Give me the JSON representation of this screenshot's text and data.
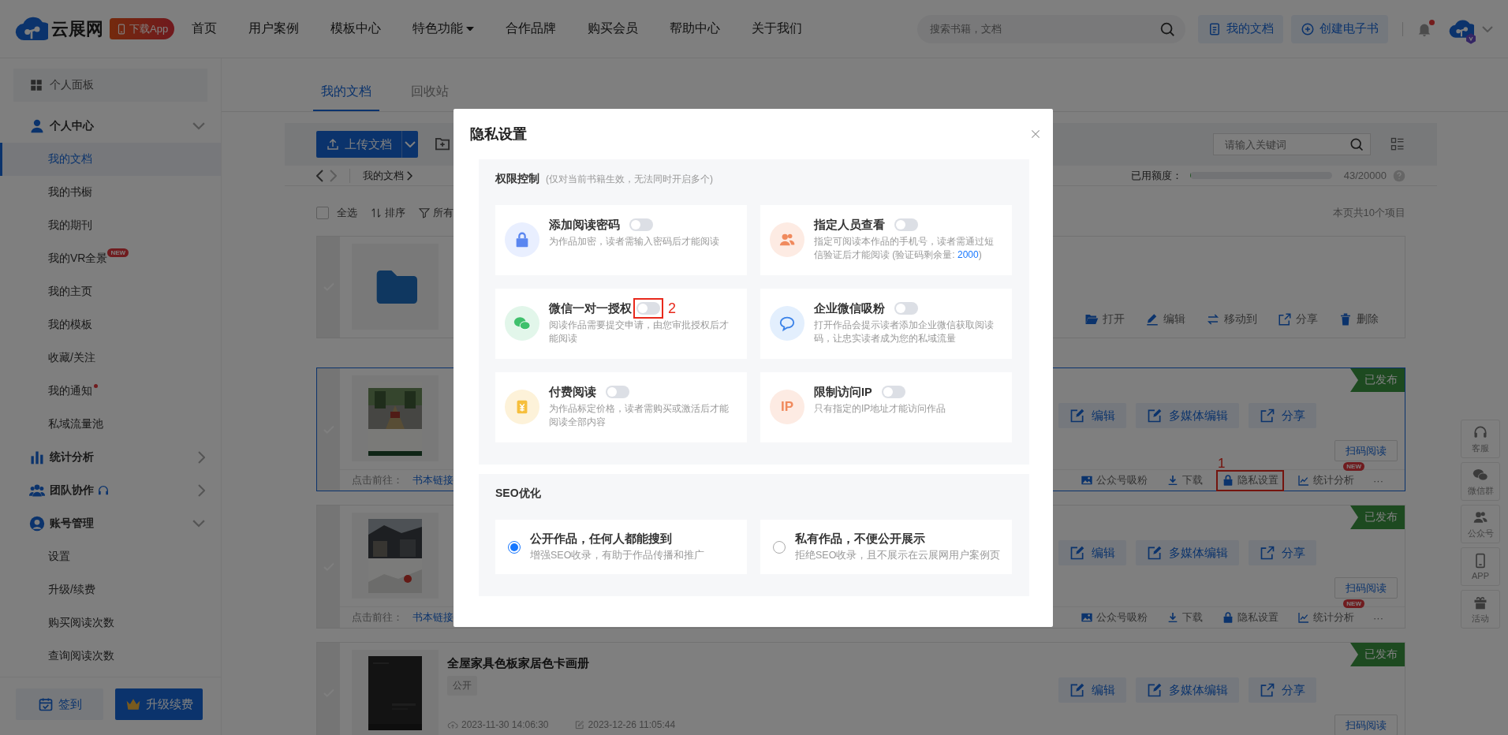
{
  "header": {
    "logo": "云展网",
    "app_badge": "下载App",
    "nav": [
      {
        "label": "首页",
        "dropdown": false
      },
      {
        "label": "用户案例",
        "dropdown": false
      },
      {
        "label": "模板中心",
        "dropdown": false
      },
      {
        "label": "特色功能",
        "dropdown": true
      },
      {
        "label": "合作品牌",
        "dropdown": false
      },
      {
        "label": "购买会员",
        "dropdown": false
      },
      {
        "label": "帮助中心",
        "dropdown": false
      },
      {
        "label": "关于我们",
        "dropdown": false
      }
    ],
    "search": {
      "placeholder": "搜索书籍，文档"
    },
    "buttons": [
      {
        "label": "我的文档",
        "kind": "docs"
      },
      {
        "label": "创建电子书",
        "kind": "create"
      }
    ],
    "notification_dot": true
  },
  "sidebar": {
    "dashboard": "个人面板",
    "groups": [
      {
        "label": "个人中心",
        "expanded": true,
        "children": [
          {
            "label": "我的文档",
            "selected": true
          },
          {
            "label": "我的书橱",
            "selected": false
          },
          {
            "label": "我的期刊",
            "selected": false
          },
          {
            "label": "我的VR全景",
            "selected": false,
            "badge": "NEW"
          },
          {
            "label": "我的主页",
            "selected": false
          },
          {
            "label": "我的模板",
            "selected": false
          },
          {
            "label": "收藏/关注",
            "selected": false
          },
          {
            "label": "我的通知",
            "selected": false,
            "dot": true
          },
          {
            "label": "私域流量池",
            "selected": false
          }
        ]
      },
      {
        "label": "统计分析",
        "expanded": false
      },
      {
        "label": "团队协作",
        "expanded": false
      },
      {
        "label": "账号管理",
        "expanded": true,
        "children": [
          {
            "label": "设置",
            "selected": false
          },
          {
            "label": "升级/续费",
            "selected": false
          },
          {
            "label": "购买阅读次数",
            "selected": false
          },
          {
            "label": "查询阅读次数",
            "selected": false
          }
        ]
      }
    ],
    "buttons": [
      {
        "label": "签到",
        "kind": "checkin"
      },
      {
        "label": "升级续费",
        "kind": "upgrade"
      }
    ]
  },
  "tabs": [
    {
      "label": "我的文档",
      "selected": true
    },
    {
      "label": "回收站",
      "selected": false
    }
  ],
  "toolbar": {
    "upload": "上传文档",
    "search": {
      "placeholder": "请输入关键词"
    }
  },
  "breadcrumb": "我的文档",
  "quota": {
    "label": "已用额度：",
    "level": 0.003,
    "reading": "43/20000"
  },
  "list_bar": {
    "select_all": "全选",
    "checked": false,
    "sort": "排序",
    "filter": "所有",
    "count": "本页共10个项目"
  },
  "documents": [
    {
      "kind": "folder",
      "selected": false,
      "actions": [
        "打开",
        "编辑",
        "移动到",
        "分享",
        "删除"
      ]
    },
    {
      "kind": "book",
      "selected": true,
      "status": "已发布",
      "buttons": [
        "编辑",
        "多媒体编辑",
        "分享"
      ],
      "scan": "扫码阅读",
      "footer": {
        "label": "点击前往：",
        "link": "书本链接",
        "actions": [
          {
            "label": "公众号吸粉",
            "highlighted": false
          },
          {
            "label": "下载",
            "highlighted": false
          },
          {
            "label": "隐私设置",
            "highlighted": true,
            "marker": "1"
          },
          {
            "label": "统计分析",
            "highlighted": false,
            "badge": "NEW"
          },
          {
            "label": "···",
            "highlighted": false
          }
        ]
      }
    },
    {
      "kind": "book",
      "selected": false,
      "status": "已发布",
      "buttons": [
        "编辑",
        "多媒体编辑",
        "分享"
      ],
      "scan": "扫码阅读",
      "footer": {
        "label": "点击前往：",
        "link": "书本链接",
        "actions": [
          {
            "label": "公众号吸粉",
            "highlighted": false
          },
          {
            "label": "下载",
            "highlighted": false
          },
          {
            "label": "隐私设置",
            "highlighted": false
          },
          {
            "label": "统计分析",
            "highlighted": false,
            "badge": "NEW"
          },
          {
            "label": "···",
            "highlighted": false
          }
        ]
      }
    },
    {
      "kind": "book",
      "selected": false,
      "title": "全屋家具色板家居色卡画册",
      "tag": "公开",
      "created": "2023-11-30 14:06:30",
      "updated": "2023-12-26 11:05:44",
      "status": "已发布",
      "buttons": [
        "编辑",
        "多媒体编辑",
        "分享"
      ],
      "scan": "扫码阅读"
    }
  ],
  "float_bar": [
    "客服",
    "微信群",
    "公众号",
    "APP",
    "活动"
  ],
  "modal": {
    "title": "隐私设置",
    "permissions": {
      "title": "权限控制",
      "note": "(仅对当前书籍生效，无法同时开启多个)",
      "items": [
        {
          "title": "添加阅读密码",
          "on": false,
          "highlighted": false,
          "desc": "为作品加密，读者需输入密码后才能阅读"
        },
        {
          "title": "指定人员查看",
          "on": false,
          "highlighted": false,
          "desc": "指定可阅读本作品的手机号，读者需通过短信验证后才能阅读 (验证码剩余量: ",
          "count": "2000",
          "desc_end": ")"
        },
        {
          "title": "微信一对一授权",
          "on": false,
          "highlighted": true,
          "marker": "2",
          "desc": "阅读作品需要提交申请，由您审批授权后才能阅读"
        },
        {
          "title": "企业微信吸粉",
          "on": false,
          "highlighted": false,
          "desc": "打开作品会提示读者添加企业微信获取阅读码，让忠实读者成为您的私域流量"
        },
        {
          "title": "付费阅读",
          "on": false,
          "highlighted": false,
          "desc": "为作品标定价格，读者需购买或激活后才能阅读全部内容"
        },
        {
          "title": "限制访问IP",
          "on": false,
          "highlighted": false,
          "icon_text": "IP",
          "desc": "只有指定的IP地址才能访问作品"
        }
      ]
    },
    "seo": {
      "title": "SEO优化",
      "options": [
        {
          "title": "公开作品，任何人都能搜到",
          "desc": "增强SEO收录，有助于作品传播和推广",
          "selected": true
        },
        {
          "title": "私有作品，不便公开展示",
          "desc": "拒绝SEO收录，且不展示在云展网用户案例页",
          "selected": false
        }
      ]
    }
  }
}
